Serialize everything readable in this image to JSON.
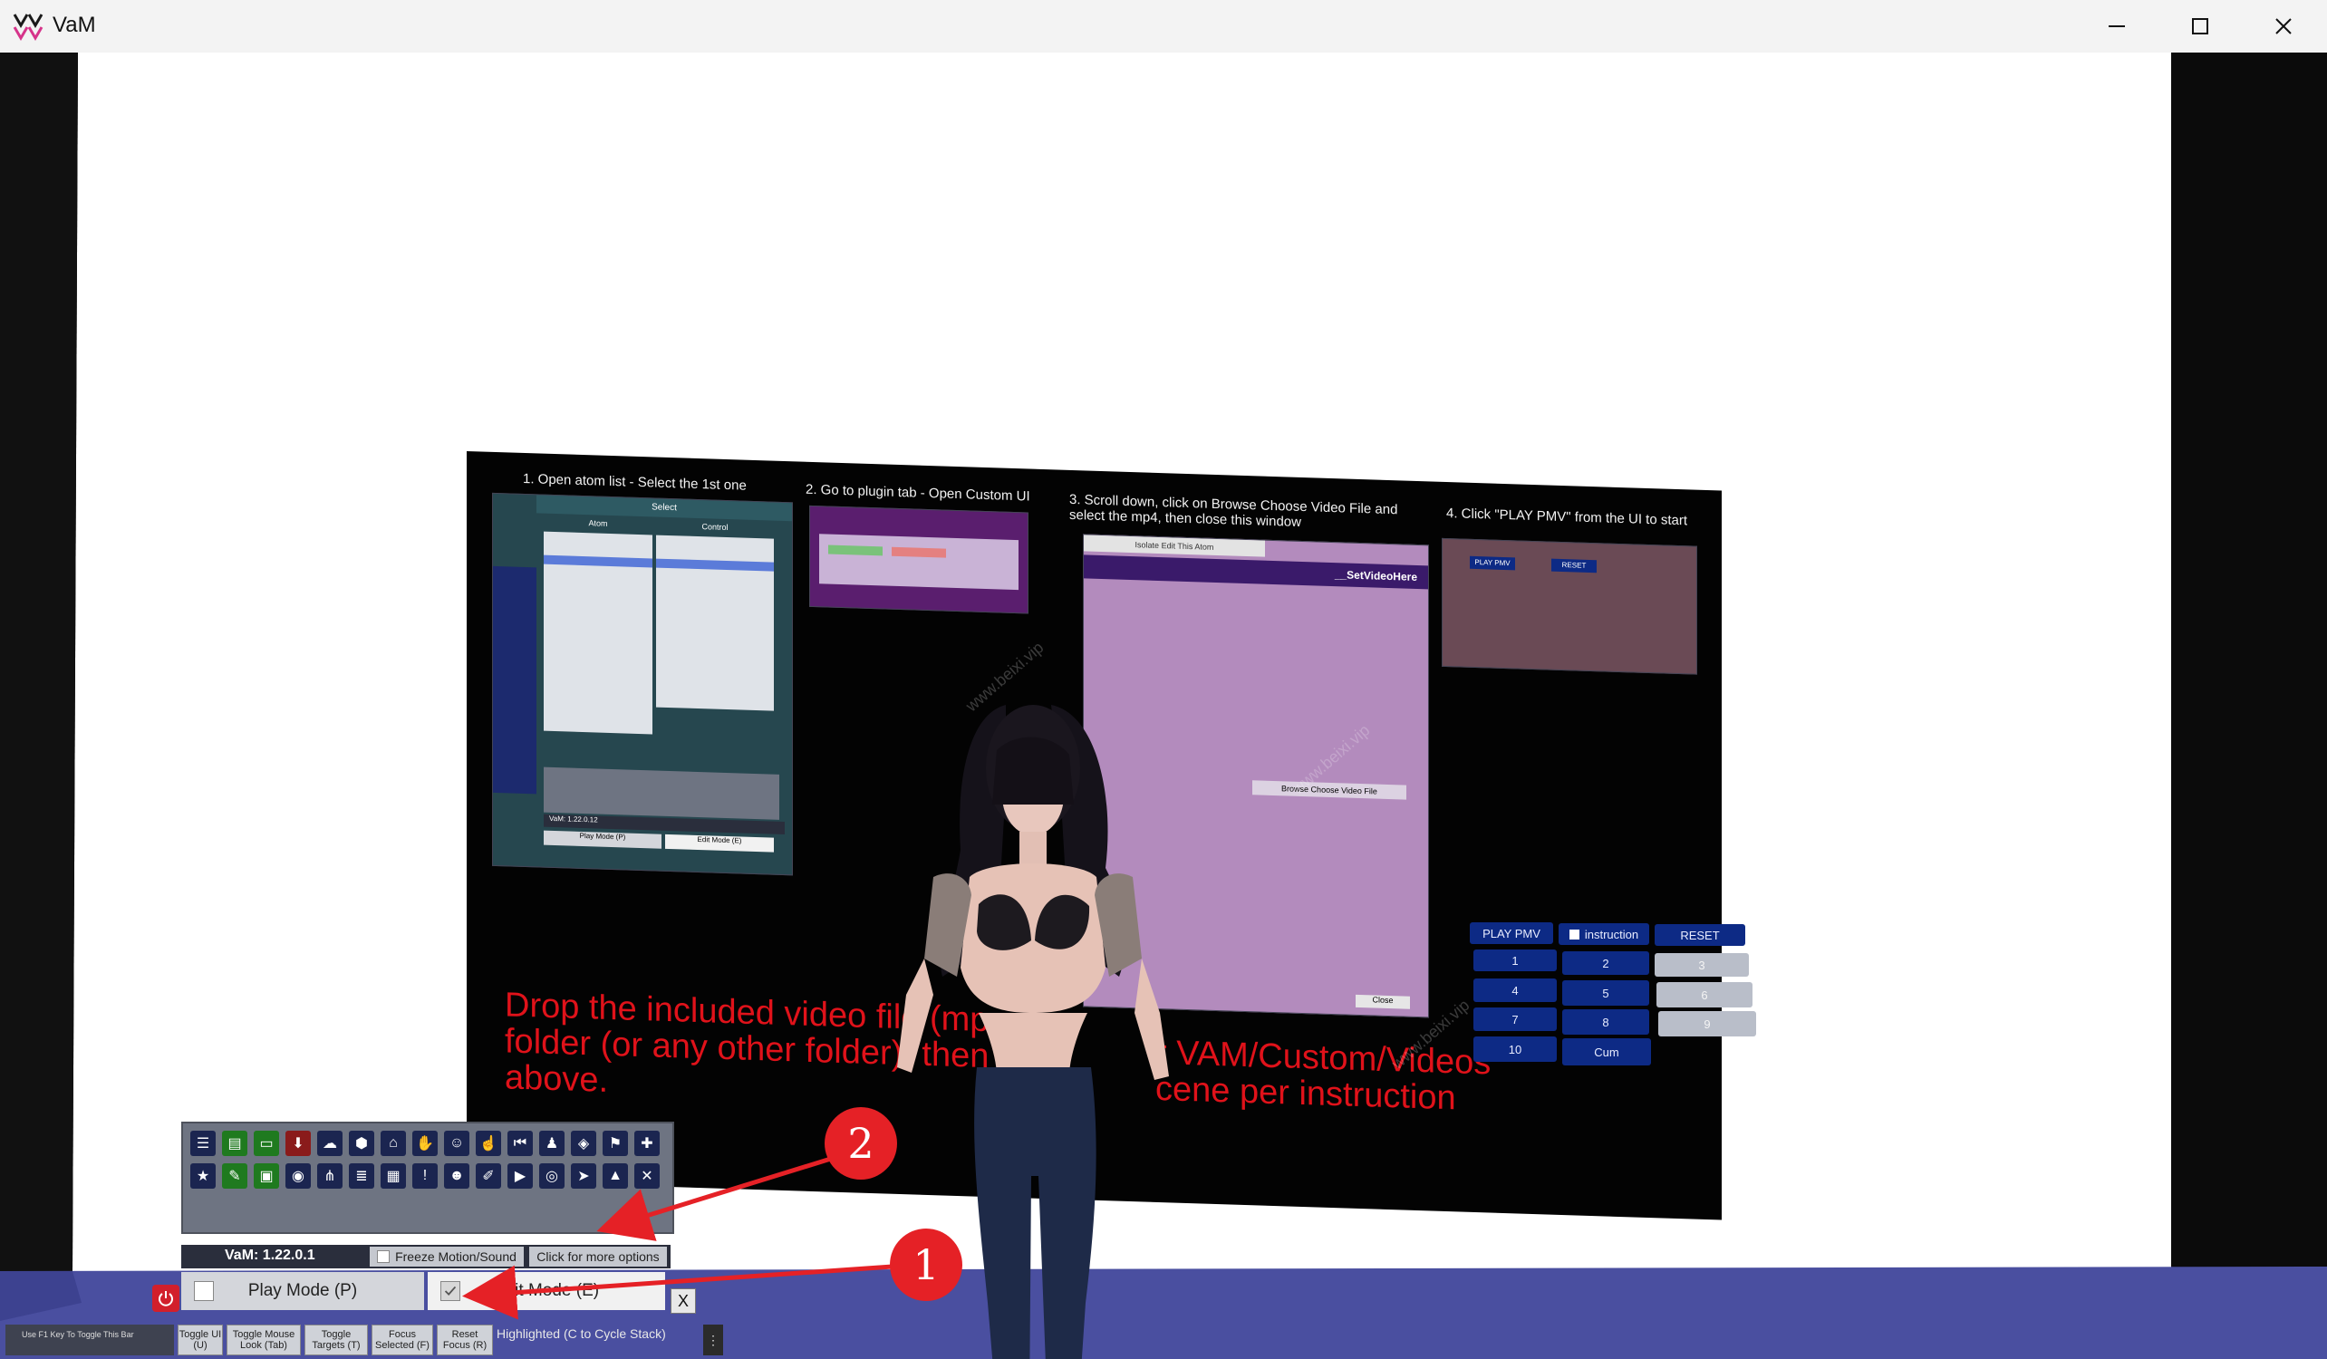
{
  "window": {
    "title": "VaM",
    "controls": [
      "minimize",
      "maximize",
      "close"
    ]
  },
  "instructions": {
    "steps": [
      "1. Open atom list - Select the 1st one",
      "2. Go to plugin tab - Open Custom UI",
      "3. Scroll down, click on Browse Choose Video File and select the mp4, then close this window",
      "4. Click \"PLAY PMV\" from the UI to start"
    ],
    "red_text_left": "Drop the included video file (mp\nfolder (or any other folder), then\nabove.",
    "red_text_right": "r VAM/Custom/Videos\ncene per instruction",
    "thumb1": {
      "header_select": "Select",
      "col_atom": "Atom",
      "col_control": "Control",
      "ver": "VaM: 1.22.0.12",
      "play": "Play Mode (P)",
      "edit": "Edit Mode (E)"
    },
    "thumb3": {
      "title": "__SetVideoHere",
      "btn": "Browse Choose Video File",
      "close": "Close",
      "isolate": "Isolate Edit This Atom"
    },
    "thumb4": {
      "play": "PLAY PMV",
      "reset": "RESET"
    }
  },
  "watermark": "www.beixi.vip",
  "pmv_panel": {
    "play": "PLAY PMV",
    "instruction": "instruction",
    "reset": "RESET",
    "buttons": [
      "1",
      "2",
      "3",
      "4",
      "5",
      "6",
      "7",
      "8",
      "9",
      "10",
      "Cum"
    ]
  },
  "toolbar": {
    "version": "VaM: 1.22.0.1",
    "freeze": "Freeze Motion/Sound",
    "more_options": "Click for more options",
    "play_mode": "Play Mode (P)",
    "edit_mode": "Edit Mode (E)",
    "close": "X",
    "row1_icons": [
      "menu-icon",
      "scene-open-icon",
      "folder-icon",
      "save-icon",
      "cloud-icon",
      "cube-icon",
      "package-icon",
      "hand-icon",
      "person-hand-icon",
      "pointer-hand-icon",
      "skip-back-icon",
      "person-icon",
      "unity-icon",
      "flag-icon",
      "plus-icon"
    ],
    "row2_icons": [
      "star-icon",
      "edit-scene-icon",
      "camera-folder-icon",
      "camera-icon",
      "nodes-icon",
      "layers-icon",
      "document-icon",
      "alert-icon",
      "user-edit-icon",
      "paint-icon",
      "play-icon",
      "target-icon",
      "select-cursor-icon",
      "mountain-icon",
      "tools-icon"
    ]
  },
  "bottom_bar": {
    "f1_tip": "Use F1 Key To Toggle This Bar",
    "buttons": [
      {
        "label": "Toggle UI (U)"
      },
      {
        "label": "Toggle Mouse Look (Tab)"
      },
      {
        "label": "Toggle Targets (T)"
      },
      {
        "label": "Focus Selected (F)"
      },
      {
        "label": "Reset Focus (R)"
      }
    ],
    "hint": "Highlighted (C to Cycle Stack)",
    "more": "⋮"
  },
  "annotations": {
    "marker1": "1",
    "marker2": "2"
  },
  "colors": {
    "accent_red": "#e52126",
    "panel_blue": "#0d2a85",
    "floor_blue": "#4a4fa0"
  }
}
